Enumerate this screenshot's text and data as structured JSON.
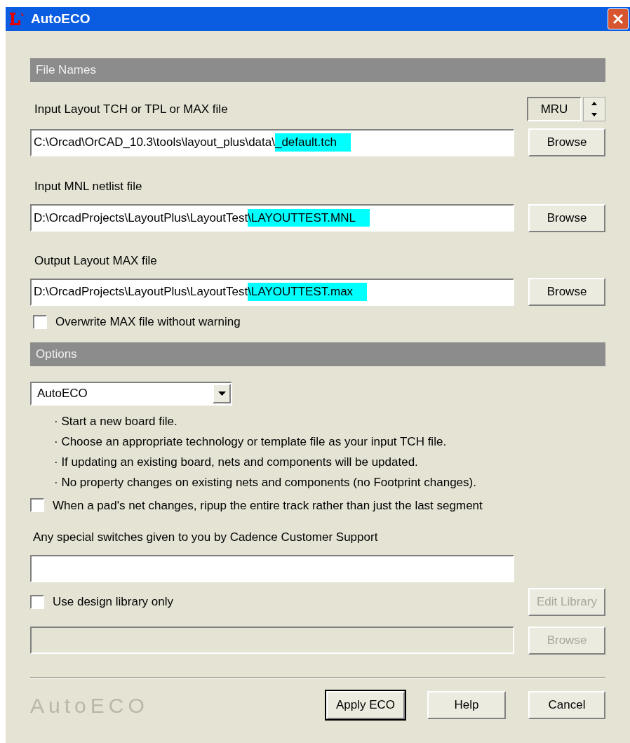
{
  "window": {
    "title": "AutoECO"
  },
  "sections": [
    {
      "title": "File Names"
    },
    {
      "title": "Options"
    }
  ],
  "mru": {
    "label": "MRU"
  },
  "file_fields": [
    {
      "label": "Input Layout TCH or TPL or MAX file",
      "path": "C:\\Orcad\\OrCAD_10.3\\tools\\layout_plus\\data\\",
      "selected_part": "_default.tch",
      "browse": "Browse"
    },
    {
      "label": "Input MNL netlist file",
      "path": "D:\\OrcadProjects\\LayoutPlus\\LayoutTest",
      "selected_part": "\\LAYOUTTEST.MNL",
      "browse": "Browse"
    },
    {
      "label": "Output Layout MAX file",
      "path": "D:\\OrcadProjects\\LayoutPlus\\LayoutTest",
      "selected_part": "\\LAYOUTTEST.max",
      "browse": "Browse"
    }
  ],
  "overwrite": {
    "label": "Overwrite MAX file without warning",
    "checked": false
  },
  "mode": {
    "value": "AutoECO"
  },
  "notes": [
    "· Start a new board file.",
    "· Choose an appropriate technology or template file as your input TCH file.",
    "· If updating an existing board, nets and components will be updated.",
    "· No property changes on existing nets and components (no Footprint changes)."
  ],
  "ripup": {
    "label": "When a pad's net changes, ripup the entire track rather than just the last segment",
    "checked": false
  },
  "switches": {
    "label": "Any special switches given to you by Cadence Customer Support"
  },
  "design_library": {
    "label": "Use design library only",
    "checked": false,
    "edit_button": "Edit Library",
    "browse": "Browse",
    "disabled": true
  },
  "logo": "AutoECO",
  "buttons": [
    {
      "label": "Apply ECO",
      "default": true
    },
    {
      "label": "Help",
      "default": false
    },
    {
      "label": "Cancel",
      "default": false
    }
  ]
}
